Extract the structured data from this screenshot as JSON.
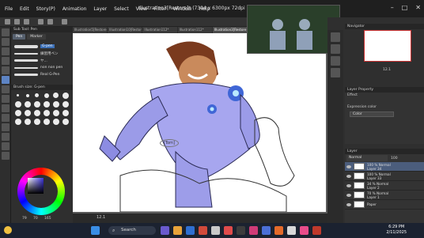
{
  "menu": [
    "File",
    "Edit",
    "Story(P)",
    "Animation",
    "Layer",
    "Select",
    "View",
    "Filter",
    "Window",
    "Help"
  ],
  "window_title": "Illustration3[Restore]* (7304 x 6300px 72dpi 10.1%) - CLIP STUDIO PAINT EX",
  "tabs": [
    "Illustration5[Restore]*",
    "Illustration10[Restore]*",
    "Illustration112*",
    "Illustration112*",
    "Illustration3[Restore]*"
  ],
  "sub_tool": {
    "header": "Sub Tool: Pen",
    "tabs": [
      "Pen",
      "Marker"
    ],
    "brushes": [
      "G-pen",
      "練習用ペン",
      "ヤ...",
      "non non pen",
      "Real G-Pen"
    ],
    "selected_index": 0
  },
  "brush_size": {
    "header": "Brush size: G-pen"
  },
  "color": {
    "values": [
      "79",
      "70",
      "165"
    ],
    "accent": "#3d33e0"
  },
  "canvas": {
    "annotation": "[Tom]"
  },
  "status": {
    "zoom": "12.1"
  },
  "navigator": {
    "header": "Navigator",
    "zoom": "12.1"
  },
  "layer_property": {
    "header": "Layer Property",
    "effect": "Effect",
    "expression_label": "Expression color",
    "expression_value": "Color"
  },
  "layers": {
    "header": "Layer",
    "blend": "Normal",
    "opacity": "100",
    "items": [
      {
        "line1": "100 % Normal",
        "line2": "Layer 34"
      },
      {
        "line1": "100 % Normal",
        "line2": "Layer 33"
      },
      {
        "line1": "34 % Normal",
        "line2": "Layer 2"
      },
      {
        "line1": "70 % Normal",
        "line2": "Layer 1"
      },
      {
        "line1": "",
        "line2": "Paper"
      }
    ],
    "selected_index": 0
  },
  "taskbar": {
    "search": "Search",
    "time": "6:29 PM",
    "date": "2/11/2025"
  }
}
